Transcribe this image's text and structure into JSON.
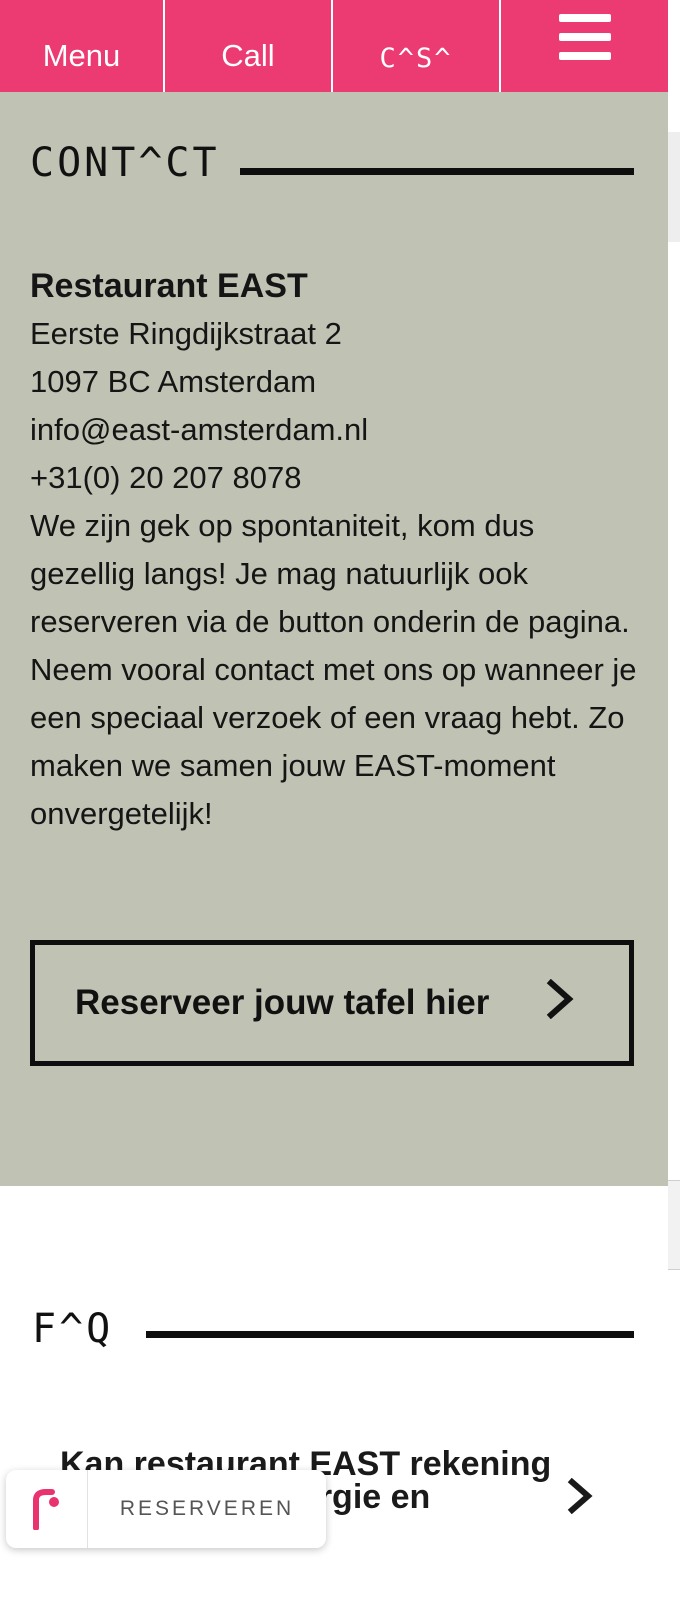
{
  "nav": {
    "menu_label": "Menu",
    "call_label": "Call",
    "casa_label": "C^S^",
    "background_color": "#ec3a73"
  },
  "contact": {
    "title": "CONT^CT",
    "restaurant_name": "Restaurant EAST",
    "street": "Eerste Ringdijkstraat 2",
    "city": "1097 BC Amsterdam",
    "email": "info@east-amsterdam.nl",
    "phone": "+31(0) 20 207 8078",
    "description": "We zijn gek op spontaniteit, kom dus gezellig langs! Je mag natuurlijk ook reserveren via de button onderin de pagina. Neem vooral contact met ons op wanneer je een speciaal verzoek of een vraag hebt. Zo maken we samen jouw EAST-moment onvergetelijk!",
    "cta_label": "Reserveer jouw tafel hier",
    "background_color": "#c0c3b3"
  },
  "faq": {
    "title": "F^Q",
    "first_question": "Kan restaurant EAST rekening houden met allergie en"
  },
  "widget": {
    "label": "RESERVEREN",
    "logo_icon": "booking-logo-icon"
  }
}
